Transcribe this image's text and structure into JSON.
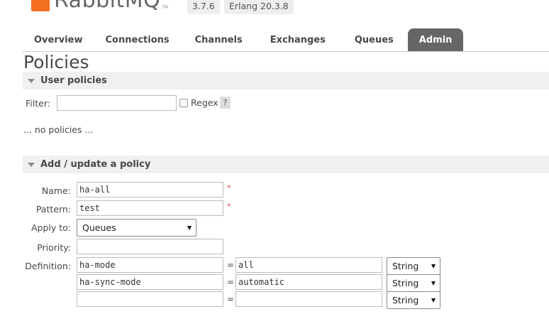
{
  "header": {
    "brand": "RabbitMQ",
    "tm": "TM",
    "version": "3.7.6",
    "erlang": "Erlang 20.3.8"
  },
  "tabs": [
    {
      "label": "Overview"
    },
    {
      "label": "Connections"
    },
    {
      "label": "Channels"
    },
    {
      "label": "Exchanges"
    },
    {
      "label": "Queues"
    },
    {
      "label": "Admin"
    }
  ],
  "page_title": "Policies",
  "user_policies": {
    "title": "User policies",
    "filter_label": "Filter:",
    "filter_value": "",
    "regex_label": "Regex",
    "help_label": "?",
    "empty_text": "... no policies ..."
  },
  "add_policy": {
    "title": "Add / update a policy",
    "name_label": "Name:",
    "name_value": "ha-all",
    "pattern_label": "Pattern:",
    "pattern_value": "test",
    "required_mark": "*",
    "apply_to_label": "Apply to:",
    "apply_to_value": "Queues",
    "priority_label": "Priority:",
    "priority_value": "",
    "definition_label": "Definition:",
    "eq": "=",
    "definition_rows": [
      {
        "key": "ha-mode",
        "value": "all",
        "type": "String"
      },
      {
        "key": "ha-sync-mode",
        "value": "automatic",
        "type": "String"
      },
      {
        "key": "",
        "value": "",
        "type": "String"
      }
    ]
  }
}
